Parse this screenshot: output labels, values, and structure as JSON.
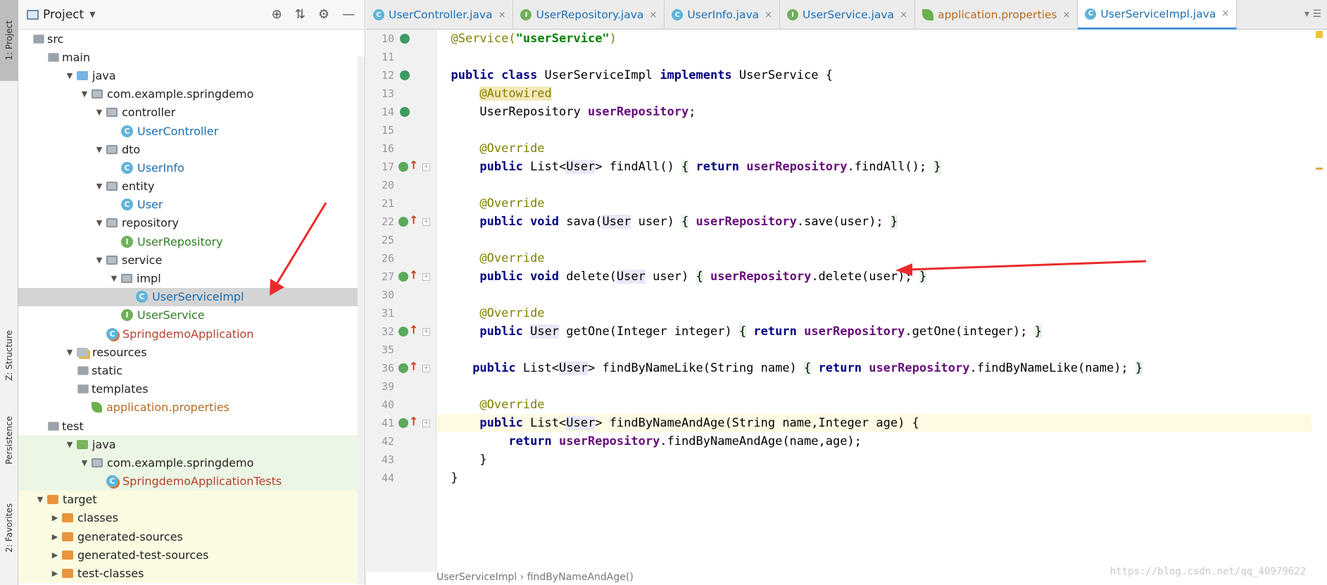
{
  "left_strip": {
    "tabs": [
      {
        "label": "1: Project",
        "selected": true
      },
      {
        "label": "Z: Structure",
        "selected": false
      },
      {
        "label": "Persistence",
        "selected": false
      },
      {
        "label": "2: Favorites",
        "selected": false
      }
    ]
  },
  "project_panel": {
    "title": "Project",
    "tools": [
      "locate-icon",
      "collapse-icon",
      "gear-icon",
      "minimize-icon"
    ],
    "tree": [
      {
        "depth": 1,
        "toggle": "open",
        "icon": "fold",
        "label": "src",
        "style": ""
      },
      {
        "depth": 2,
        "toggle": "open",
        "icon": "fold",
        "label": "main",
        "style": ""
      },
      {
        "depth": 3,
        "toggle": "open",
        "icon": "foldblue",
        "label": "java",
        "style": ""
      },
      {
        "depth": 4,
        "toggle": "open",
        "icon": "pkg",
        "label": "com.example.springdemo",
        "style": ""
      },
      {
        "depth": 5,
        "toggle": "open",
        "icon": "pkg",
        "label": "controller",
        "style": ""
      },
      {
        "depth": 6,
        "toggle": "",
        "icon": "cls",
        "label": "UserController",
        "style": "blue"
      },
      {
        "depth": 5,
        "toggle": "open",
        "icon": "pkg",
        "label": "dto",
        "style": ""
      },
      {
        "depth": 6,
        "toggle": "",
        "icon": "cls",
        "label": "UserInfo",
        "style": "blue"
      },
      {
        "depth": 5,
        "toggle": "open",
        "icon": "pkg",
        "label": "entity",
        "style": ""
      },
      {
        "depth": 6,
        "toggle": "",
        "icon": "cls",
        "label": "User",
        "style": "blue"
      },
      {
        "depth": 5,
        "toggle": "open",
        "icon": "pkg",
        "label": "repository",
        "style": ""
      },
      {
        "depth": 6,
        "toggle": "",
        "icon": "itf",
        "label": "UserRepository",
        "style": "green"
      },
      {
        "depth": 5,
        "toggle": "open",
        "icon": "pkg",
        "label": "service",
        "style": ""
      },
      {
        "depth": 6,
        "toggle": "open",
        "icon": "pkg",
        "label": "impl",
        "style": ""
      },
      {
        "depth": 7,
        "toggle": "",
        "icon": "cls",
        "label": "UserServiceImpl",
        "style": "blue",
        "selected": true
      },
      {
        "depth": 6,
        "toggle": "",
        "icon": "itf",
        "label": "UserService",
        "style": "green"
      },
      {
        "depth": 5,
        "toggle": "",
        "icon": "app",
        "label": "SpringdemoApplication",
        "style": "red"
      },
      {
        "depth": 3,
        "toggle": "open",
        "icon": "res",
        "label": "resources",
        "style": ""
      },
      {
        "depth": 4,
        "toggle": "",
        "icon": "fold",
        "label": "static",
        "style": ""
      },
      {
        "depth": 4,
        "toggle": "",
        "icon": "fold",
        "label": "templates",
        "style": ""
      },
      {
        "depth": 4,
        "toggle": "",
        "icon": "leaf",
        "label": "application.properties",
        "style": "orange"
      },
      {
        "depth": 2,
        "toggle": "open",
        "icon": "fold",
        "label": "test",
        "style": ""
      },
      {
        "depth": 3,
        "toggle": "open",
        "icon": "foldgreen",
        "label": "java",
        "style": "",
        "bg": "green"
      },
      {
        "depth": 4,
        "toggle": "open",
        "icon": "pkg",
        "label": "com.example.springdemo",
        "style": "",
        "bg": "green"
      },
      {
        "depth": 5,
        "toggle": "",
        "icon": "app",
        "label": "SpringdemoApplicationTests",
        "style": "red",
        "bg": "green"
      },
      {
        "depth": 1,
        "toggle": "open",
        "icon": "foldorange",
        "label": "target",
        "style": "",
        "bg": "yellow"
      },
      {
        "depth": 2,
        "toggle": "closed",
        "icon": "foldorange",
        "label": "classes",
        "style": "",
        "bg": "yellow"
      },
      {
        "depth": 2,
        "toggle": "closed",
        "icon": "foldorange",
        "label": "generated-sources",
        "style": "",
        "bg": "yellow"
      },
      {
        "depth": 2,
        "toggle": "closed",
        "icon": "foldorange",
        "label": "generated-test-sources",
        "style": "",
        "bg": "yellow"
      },
      {
        "depth": 2,
        "toggle": "closed",
        "icon": "foldorange",
        "label": "test-classes",
        "style": "",
        "bg": "yellow"
      }
    ]
  },
  "editor_tabs": [
    {
      "label": "UserController.java",
      "icon": "c",
      "active": false
    },
    {
      "label": "UserRepository.java",
      "icon": "i",
      "active": false
    },
    {
      "label": "UserInfo.java",
      "icon": "c",
      "active": false
    },
    {
      "label": "UserService.java",
      "icon": "i",
      "active": false
    },
    {
      "label": "application.properties",
      "icon": "l",
      "active": false,
      "orange": true
    },
    {
      "label": "UserServiceImpl.java",
      "icon": "c",
      "active": true
    }
  ],
  "code_lines": [
    {
      "n": "10",
      "gutter": "bean",
      "html": "<span class=\"ann\">@Service(</span><span class=\"str\">\"userService\"</span><span class=\"ann\">)</span>"
    },
    {
      "n": "11",
      "gutter": "",
      "html": ""
    },
    {
      "n": "12",
      "gutter": "bean",
      "html": "<span class=\"kw\">public class</span> UserServiceImpl <span class=\"kw\">implements</span> UserService {"
    },
    {
      "n": "13",
      "gutter": "",
      "html": "    <span class=\"ann2\">@Autowired</span>"
    },
    {
      "n": "14",
      "gutter": "bean",
      "html": "    UserRepository <span class=\"fld\">userRepository</span>;"
    },
    {
      "n": "15",
      "gutter": "",
      "html": ""
    },
    {
      "n": "16",
      "gutter": "",
      "html": "    <span class=\"ann\">@Override</span>"
    },
    {
      "n": "17",
      "gutter": "impl",
      "fold": true,
      "html": "    <span class=\"kw\">public</span> List&lt;<span class=\"typ\">User</span>&gt; findAll() <span class=\"brk\">{</span> <span class=\"kw\">return</span> <span class=\"fld\">userRepository</span>.findAll(); <span class=\"brk\">}</span>"
    },
    {
      "n": "20",
      "gutter": "",
      "html": ""
    },
    {
      "n": "21",
      "gutter": "",
      "html": "    <span class=\"ann\">@Override</span>"
    },
    {
      "n": "22",
      "gutter": "impl",
      "fold": true,
      "html": "    <span class=\"kw\">public void</span> sava(<span class=\"typ\">User</span> user) <span class=\"brk\">{</span> <span class=\"fld\">userRepository</span>.save(user); <span class=\"brk\">}</span>"
    },
    {
      "n": "25",
      "gutter": "",
      "html": ""
    },
    {
      "n": "26",
      "gutter": "",
      "html": "    <span class=\"ann\">@Override</span>"
    },
    {
      "n": "27",
      "gutter": "impl",
      "fold": true,
      "html": "    <span class=\"kw\">public void</span> delete(<span class=\"typ\">User</span> user) <span class=\"brk\">{</span> <span class=\"fld\">userRepository</span>.delete(user); <span class=\"brk\">}</span>"
    },
    {
      "n": "30",
      "gutter": "",
      "html": ""
    },
    {
      "n": "31",
      "gutter": "",
      "html": "    <span class=\"ann\">@Override</span>"
    },
    {
      "n": "32",
      "gutter": "impl",
      "fold": true,
      "html": "    <span class=\"kw\">public</span> <span class=\"typ\">User</span> getOne(Integer integer) <span class=\"brk\">{</span> <span class=\"kw\">return</span> <span class=\"fld\">userRepository</span>.getOne(integer); <span class=\"brk\">}</span>"
    },
    {
      "n": "35",
      "gutter": "",
      "html": ""
    },
    {
      "n": "36",
      "gutter": "impl",
      "fold": true,
      "html": "   <span class=\"kw\">public</span> List&lt;<span class=\"typ\">User</span>&gt; findByNameLike(String name) <span class=\"brk\">{</span> <span class=\"kw\">return</span> <span class=\"fld\">userRepository</span>.findByNameLike(name); <span class=\"brk\">}</span>"
    },
    {
      "n": "39",
      "gutter": "",
      "html": ""
    },
    {
      "n": "40",
      "gutter": "",
      "html": "    <span class=\"ann\">@Override</span>"
    },
    {
      "n": "41",
      "gutter": "impl",
      "fold": true,
      "cur": true,
      "bulb": true,
      "html": "    <span class=\"kw\">public</span> List&lt;<span class=\"typ\">User</span>&gt; findByNameAndAge(String name,Integer age) {"
    },
    {
      "n": "42",
      "gutter": "",
      "html": "        <span class=\"kw\">return</span> <span class=\"fld\">userRepository</span>.findByNameAndAge(name,age);"
    },
    {
      "n": "43",
      "gutter": "",
      "html": "    }"
    },
    {
      "n": "44",
      "gutter": "",
      "html": "}"
    }
  ],
  "breadcrumb": {
    "items": [
      "UserServiceImpl",
      "findByNameAndAge()"
    ],
    "sep": "›"
  },
  "watermark": "https://blog.csdn.net/qq_40979622"
}
